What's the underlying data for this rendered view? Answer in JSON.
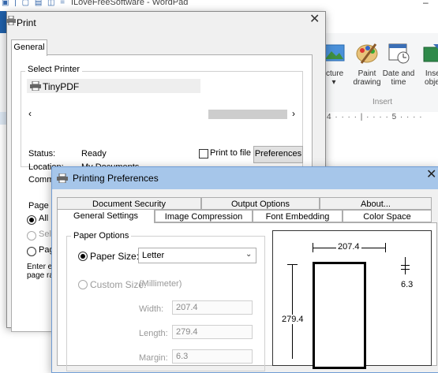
{
  "wordpad": {
    "title": "ILoveFreeSoftware - WordPad",
    "ribbon": {
      "buttons": [
        {
          "label": "icture",
          "sub": "▾"
        },
        {
          "label": "Paint",
          "sub": "drawing"
        },
        {
          "label": "Date and",
          "sub": "time"
        },
        {
          "label": "Inser",
          "sub": "objec"
        }
      ],
      "group_label": "Insert"
    },
    "ruler_text": "4 · · · · | · · · · 5 · · · ·"
  },
  "print_dialog": {
    "title": "Print",
    "tab": "General",
    "select_printer_label": "Select Printer",
    "printer_name": "TinyPDF",
    "status_label": "Status:",
    "status_value": "Ready",
    "location_label": "Location:",
    "location_value": "My Documents",
    "comment_label": "Comme",
    "print_to_file_label": "Print to file",
    "preferences_button": "Preferences",
    "page_range_label": "Page R",
    "range_all": "All",
    "range_selection": "Sele",
    "range_pages": "Pag",
    "enter_text_1": "Enter ei",
    "enter_text_2": "page ra"
  },
  "preferences_dialog": {
    "title": "Printing Preferences",
    "tabs_row1": [
      "Document Security",
      "Output Options",
      "About..."
    ],
    "tabs_row2": [
      "General Settings",
      "Image Compression",
      "Font Embedding",
      "Color Space"
    ],
    "paper_options_label": "Paper Options",
    "paper_size_label": "Paper Size:",
    "paper_size_value": "Letter",
    "custom_size_label": "Custom Size:",
    "unit_label": "(Millimeter)",
    "width_label": "Width:",
    "width_value": "207.4",
    "length_label": "Length:",
    "length_value": "279.4",
    "margin_label": "Margin:",
    "margin_value": "6.3",
    "preview_width": "207.4",
    "preview_height": "279.4",
    "preview_margin": "6.3"
  }
}
